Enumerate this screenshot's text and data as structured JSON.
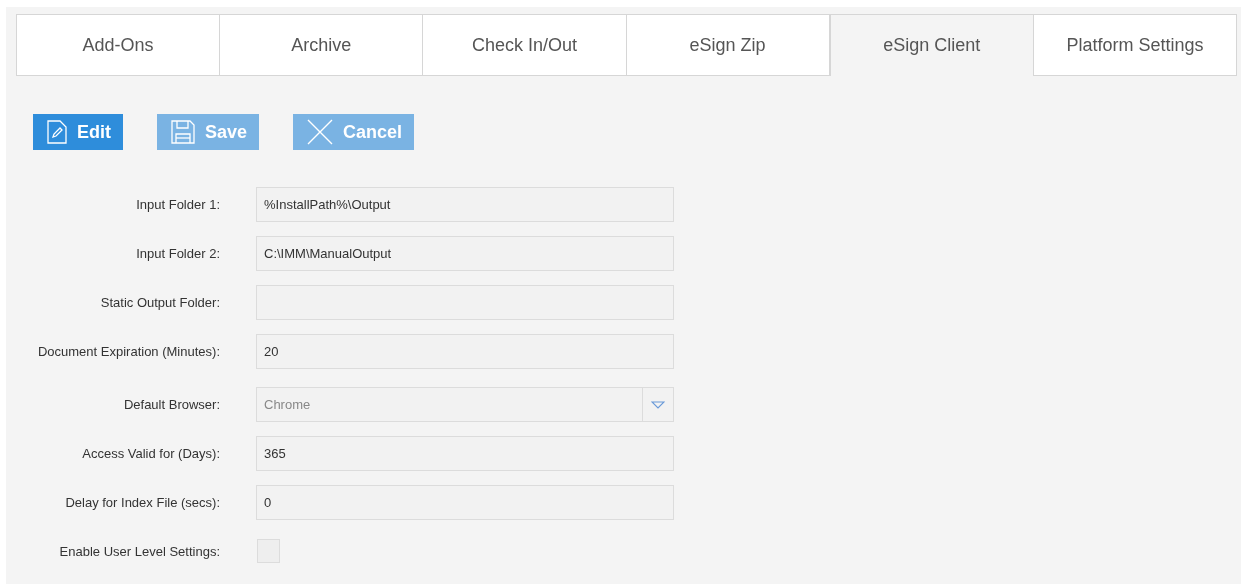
{
  "tabs": [
    {
      "label": "Add-Ons",
      "selected": false
    },
    {
      "label": "Archive",
      "selected": false
    },
    {
      "label": "Check In/Out",
      "selected": false
    },
    {
      "label": "eSign Zip",
      "selected": false
    },
    {
      "label": "eSign Client",
      "selected": true
    },
    {
      "label": "Platform Settings",
      "selected": false
    }
  ],
  "buttons": [
    {
      "label": "Edit",
      "kind": "edit",
      "disabled": false
    },
    {
      "label": "Save",
      "kind": "save",
      "disabled": true
    },
    {
      "label": "Cancel",
      "kind": "cancel",
      "disabled": true
    }
  ],
  "fields": [
    {
      "label": "Input Folder 1:",
      "kind": "text",
      "value": "%InstallPath%\\Output"
    },
    {
      "label": "Input Folder 2:",
      "kind": "text",
      "value": "C:\\IMM\\ManualOutput"
    },
    {
      "label": "Static Output Folder:",
      "kind": "text"
    },
    {
      "label": "Document Expiration (Minutes):",
      "kind": "text",
      "value": "20"
    },
    {
      "label": "Default Browser:",
      "kind": "select",
      "value": "Chrome"
    },
    {
      "label": "Access Valid for (Days):",
      "kind": "text",
      "value": "365"
    },
    {
      "label": "Delay for Index File (secs):",
      "kind": "text",
      "value": "0"
    },
    {
      "label": "Enable User Level Settings:",
      "kind": "checkbox",
      "checked": false
    }
  ]
}
